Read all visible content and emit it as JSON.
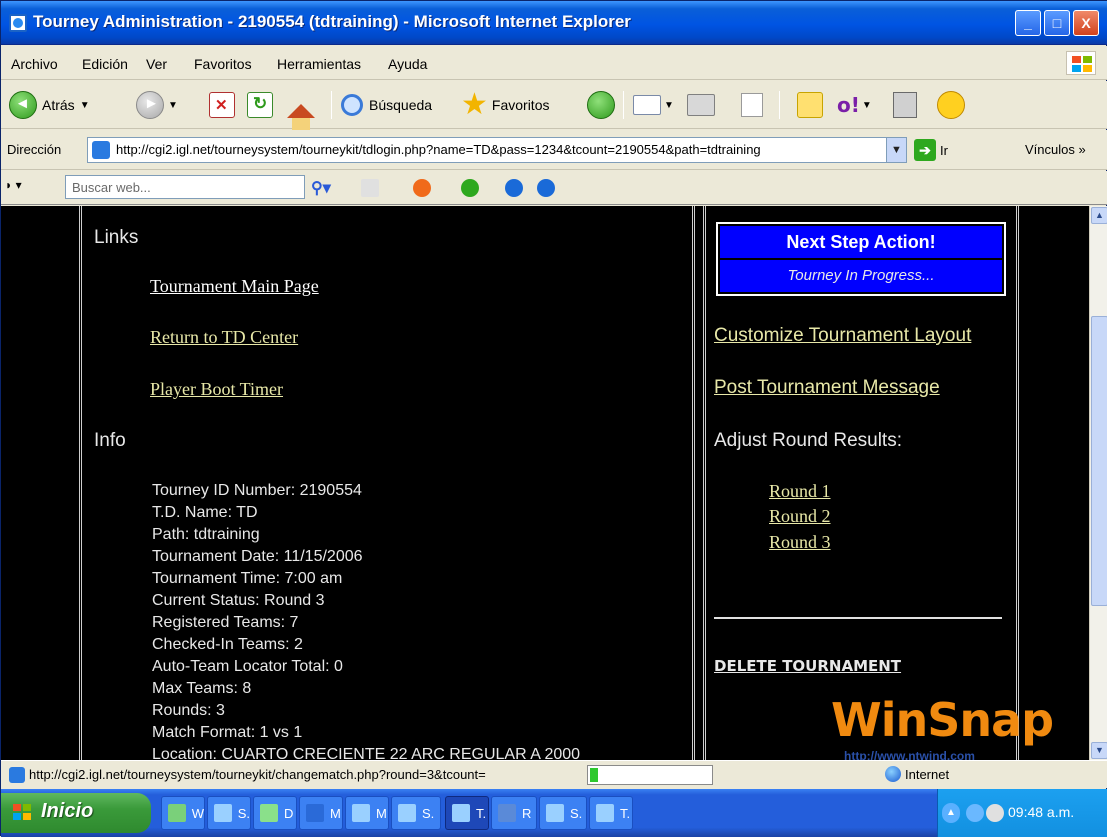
{
  "window": {
    "title": "Tourney Administration - 2190554 (tdtraining) - Microsoft Internet Explorer",
    "btn_min": "_",
    "btn_max": "□",
    "btn_close": "X"
  },
  "menu": [
    "Archivo",
    "Edición",
    "Ver",
    "Favoritos",
    "Herramientas",
    "Ayuda"
  ],
  "toolbar": {
    "back_label": "Atrás",
    "search_label": "Búsqueda",
    "favorites_label": "Favoritos"
  },
  "address": {
    "label": "Dirección",
    "url": "http://cgi2.igl.net/tourneysystem/tourneykit/tdlogin.php?name=TD&pass=1234&tcount=2190554&path=tdtraining",
    "go_label": "Ir",
    "links_label": "Vínculos"
  },
  "searchbar": {
    "placeholder": "Buscar web..."
  },
  "page": {
    "links_heading": "Links",
    "links": [
      "Tournament Main Page",
      "Return to TD Center",
      "Player Boot Timer"
    ],
    "info_heading": "Info",
    "info_lines": [
      "Tourney ID Number: 2190554",
      "T.D. Name: TD",
      "Path: tdtraining",
      "Tournament Date: 11/15/2006",
      "Tournament Time: 7:00 am",
      "Current Status: Round 3",
      "Registered Teams: 7",
      "Checked-In Teams: 2",
      "Auto-Team Locator Total: 0",
      "Max Teams: 8",
      "Rounds: 3",
      "Match Format: 1 vs 1",
      "Location: CUARTO CRECIENTE 22 ARC REGULAR A 2000"
    ],
    "next_step_title": "Next Step Action!",
    "next_step_status": "Tourney In Progress...",
    "customize_link": "Customize Tournament Layout",
    "post_message_link": "Post Tournament Message",
    "adjust_label": "Adjust Round Results:",
    "rounds": [
      "Round 1",
      "Round 2",
      "Round 3"
    ],
    "delete_link": "DELETE TOURNAMENT"
  },
  "watermark": {
    "brand": "WinSnap",
    "url": "http://www.ntwind.com"
  },
  "status": {
    "text": "http://cgi2.igl.net/tourneysystem/tourneykit/changematch.php?round=3&tcount=",
    "zone": "Internet"
  },
  "taskbar": {
    "start_label": "Inicio",
    "tasks": [
      {
        "label": "W",
        "active": false
      },
      {
        "label": "S.",
        "active": false
      },
      {
        "label": "D",
        "active": false
      },
      {
        "label": "M",
        "active": false
      },
      {
        "label": "M",
        "active": false
      },
      {
        "label": "S.",
        "active": false
      },
      {
        "label": "T.",
        "active": true
      },
      {
        "label": "R",
        "active": false
      },
      {
        "label": "S.",
        "active": false
      },
      {
        "label": "T.",
        "active": false
      }
    ],
    "clock": "09:48 a.m."
  },
  "colors": {
    "page_bg": "#000000",
    "link": "#e8e8a8",
    "next_step_bg": "#0000ff",
    "titlebar": "#0054e3",
    "taskbar": "#245edb",
    "start": "#3a9a3a",
    "watermark": "#f08a10"
  }
}
